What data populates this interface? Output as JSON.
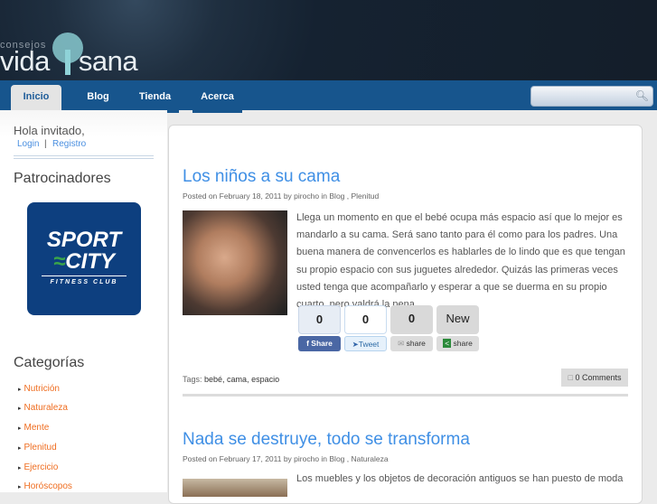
{
  "logo": {
    "small": "consejos",
    "left": "vida",
    "right": "sana"
  },
  "nav": {
    "tabs": [
      {
        "label": "Inicio"
      },
      {
        "label": "Blog"
      },
      {
        "label": "Tienda"
      },
      {
        "label": "Acerca"
      }
    ],
    "search_placeholder": ""
  },
  "sidebar": {
    "greeting": "Hola invitado,",
    "login": "Login",
    "separator": "|",
    "register": "Registro",
    "sponsors_title": "Patrocinadores",
    "sponsor": {
      "line1": "SPORT",
      "line2": "CITY",
      "line3": "FITNESS CLUB"
    },
    "categories_title": "Categorías",
    "categories": [
      "Nutrición",
      "Naturaleza",
      "Mente",
      "Plenitud",
      "Ejercicio",
      "Horóscopos"
    ]
  },
  "posts": [
    {
      "title": "Los niños a su cama",
      "meta": "Posted on February 18, 2011 by pirocho in Blog , Plenitud",
      "text": "Llega un momento en que el bebé ocupa más espacio así que lo mejor es mandarlo a su cama. Será sano tanto para él como para los padres. Una buena manera de convencerlos es hablarles de lo lindo que es que tengan su propio espacio con sus juguetes alrededor. Quizás las primeras veces usted tenga que acompañarlo y esperar a que se duerma en su propio cuarto, pero valdrá la pena.",
      "share": [
        {
          "count": "0",
          "label": "Share"
        },
        {
          "count": "0",
          "label": "Tweet"
        },
        {
          "count": "0",
          "label": "share"
        },
        {
          "count": "New",
          "label": "share"
        }
      ],
      "tags_label": "Tags:",
      "tags": "bebé, cama, espacio",
      "comments": "0 Comments"
    },
    {
      "title": "Nada se destruye, todo se transforma",
      "meta": "Posted on February 17, 2011 by pirocho in Blog , Naturaleza",
      "text": "Los muebles y los objetos de decoración antiguos se han puesto de moda"
    }
  ]
}
